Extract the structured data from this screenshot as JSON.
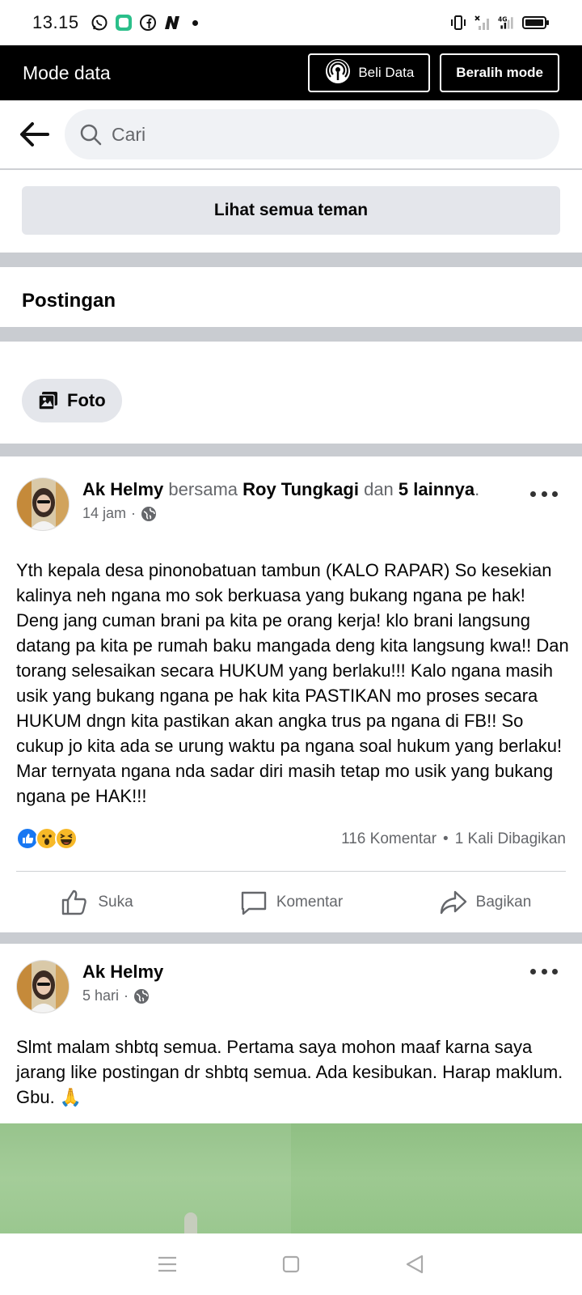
{
  "status_bar": {
    "time": "13.15",
    "left_icons": [
      "whatsapp-icon",
      "messenger-app-icon",
      "facebook-icon",
      "n-app-icon"
    ],
    "right_icons": [
      "vibrate-icon",
      "no-signal-icon",
      "4g-signal-icon",
      "battery-icon"
    ]
  },
  "data_mode_bar": {
    "title": "Mode data",
    "buy_button": "Beli Data",
    "switch_button": "Beralih mode"
  },
  "search": {
    "placeholder": "Cari"
  },
  "friends": {
    "see_all_label": "Lihat semua teman"
  },
  "posts_section": {
    "title": "Postingan",
    "filter_chip": "Foto"
  },
  "posts": [
    {
      "author": "Ak Helmy",
      "with_word": "bersama",
      "tagged": "Roy Tungkagi",
      "and_word": "dan",
      "others": "5 lainnya",
      "period": ".",
      "time": "14 jam",
      "privacy_icon": "globe-icon",
      "text": "Yth kepala desa pinonobatuan tambun (KALO RAPAR) So kesekian kalinya neh ngana mo sok berkuasa yang bukang ngana pe hak! Deng jang cuman brani pa kita pe orang kerja! klo brani langsung datang pa kita pe rumah baku mangada deng kita langsung kwa!! Dan torang selesaikan secara HUKUM yang berlaku!!! Kalo ngana masih usik yang bukang ngana pe hak kita PASTIKAN mo proses secara HUKUM dngn kita pastikan akan angka trus pa ngana di FB!! So cukup jo kita ada se urung waktu pa ngana soal hukum yang berlaku! Mar ternyata ngana nda sadar diri masih tetap mo usik yang bukang ngana pe HAK!!!",
      "reactions": [
        "like-reaction-icon",
        "wow-reaction-icon",
        "haha-reaction-icon"
      ],
      "comments": "116 Komentar",
      "shares": "1 Kali Dibagikan",
      "actions": {
        "like": "Suka",
        "comment": "Komentar",
        "share": "Bagikan"
      }
    },
    {
      "author": "Ak Helmy",
      "time": "5 hari",
      "privacy_icon": "globe-icon",
      "text": "Slmt malam shbtq semua. Pertama saya mohon maaf karna saya jarang like postingan dr shbtq semua. Ada kesibukan. Harap maklum. Gbu. 🙏"
    }
  ],
  "colors": {
    "data_bar_bg": "#000000",
    "separator": "#c9ccd1",
    "chip_bg": "#e4e6eb",
    "muted_text": "#65676b",
    "like_blue": "#1877f2",
    "reaction_yellow": "#f7b928"
  }
}
